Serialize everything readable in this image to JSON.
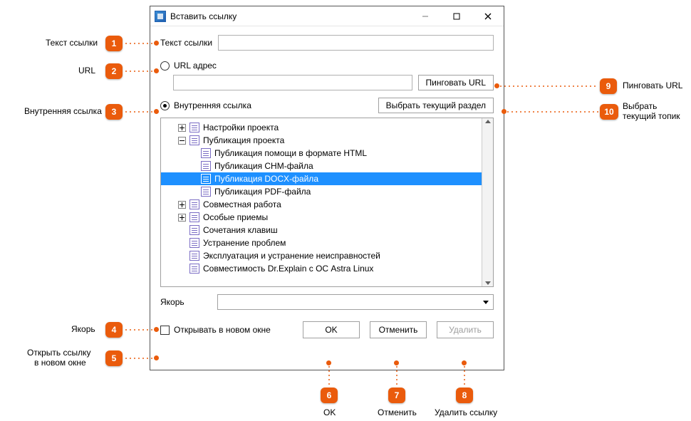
{
  "window": {
    "title": "Вставить ссылку"
  },
  "fields": {
    "link_text_label": "Текст ссылки",
    "url_radio_label": "URL адрес",
    "internal_radio_label": "Внутренняя ссылка",
    "anchor_label": "Якорь",
    "open_new_window_label": "Открывать в новом окне"
  },
  "buttons": {
    "ping_url": "Пинговать URL",
    "select_current_topic": "Выбрать текущий раздел",
    "ok": "OK",
    "cancel": "Отменить",
    "delete": "Удалить"
  },
  "tree": {
    "n0": "Настройки проекта",
    "n1": "Публикация проекта",
    "n1a": "Публикация помощи в формате HTML",
    "n1b": "Публикация CHM-файла",
    "n1c": "Публикация DOCX-файла",
    "n1d": "Публикация PDF-файла",
    "n2": "Совместная работа",
    "n3": "Особые приемы",
    "n4": "Сочетания клавиш",
    "n5": "Устранение проблем",
    "n6": "Эксплуатация и устранение неисправностей",
    "n7": "Совместимость Dr.Explain с ОС Astra Linux"
  },
  "callouts": {
    "c1_label": "Текст ссылки",
    "c2_label": "URL",
    "c3_label": "Внутренняя ссылка",
    "c4_label": "Якорь",
    "c5_label1": "Открыть ссылку",
    "c5_label2": "в новом окне",
    "c6_label": "OK",
    "c7_label": "Отменить",
    "c8_label": "Удалить ссылку",
    "c9_label": "Пинговать URL",
    "c10_label1": "Выбрать",
    "c10_label2": "текущий топик",
    "n1": "1",
    "n2": "2",
    "n3": "3",
    "n4": "4",
    "n5": "5",
    "n6": "6",
    "n7": "7",
    "n8": "8",
    "n9": "9",
    "n10": "10"
  }
}
